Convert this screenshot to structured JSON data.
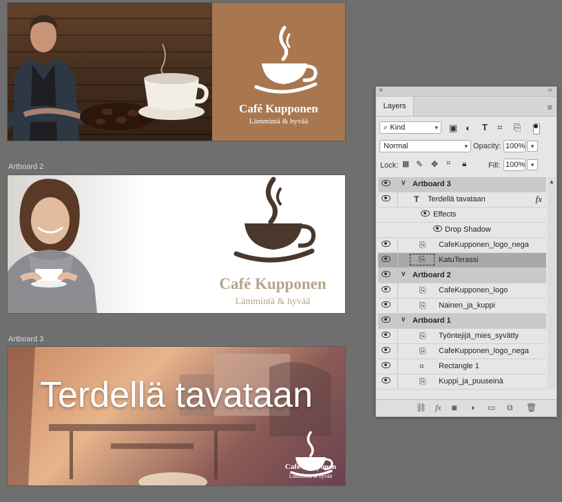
{
  "artboards": [
    {
      "id": "ab1",
      "label": "",
      "logo_title": "Café Kupponen",
      "logo_sub": "Lämmintä & hyvää"
    },
    {
      "id": "ab2",
      "label": "Artboard 2",
      "logo_title": "Café Kupponen",
      "logo_sub": "Lämmintä & hyvää"
    },
    {
      "id": "ab3",
      "label": "Artboard 3",
      "headline": "Terdellä tavataan",
      "logo_title": "Café Kupponen",
      "logo_sub": "Lämmintä & hyvää"
    }
  ],
  "panel": {
    "tab": "Layers",
    "filter_kind": "Kind",
    "blend_mode": "Normal",
    "opacity_label": "Opacity:",
    "opacity_value": "100%",
    "lock_label": "Lock:",
    "fill_label": "Fill:",
    "fill_value": "100%",
    "fx_label": "fx",
    "layers": [
      {
        "name": "Artboard 3",
        "kind": "group",
        "caret": "∨"
      },
      {
        "name": "Terdellä tavataan",
        "kind": "text",
        "fx": "fx"
      },
      {
        "name": "Effects",
        "kind": "effects"
      },
      {
        "name": "Drop Shadow",
        "kind": "effect"
      },
      {
        "name": "CafeKupponen_logo_nega",
        "kind": "smart"
      },
      {
        "name": "KatuTerassi",
        "kind": "smart",
        "selected": true
      },
      {
        "name": "Artboard 2",
        "kind": "group",
        "caret": "∨"
      },
      {
        "name": "CafeKupponen_logo",
        "kind": "smart"
      },
      {
        "name": "Nainen_ja_kuppi",
        "kind": "smart"
      },
      {
        "name": "Artboard 1",
        "kind": "group",
        "caret": "∨"
      },
      {
        "name": "Työntejijä_mies_syvätty",
        "kind": "smart"
      },
      {
        "name": "CafeKupponen_logo_nega",
        "kind": "smart"
      },
      {
        "name": "Rectangle 1",
        "kind": "shape"
      },
      {
        "name": "Kuppi_ja_puuseinä",
        "kind": "smart"
      }
    ]
  },
  "colors": {
    "accent_brown": "#a8774f",
    "logo_dark": "#4a382c",
    "logo_light": "#b4a48f"
  }
}
